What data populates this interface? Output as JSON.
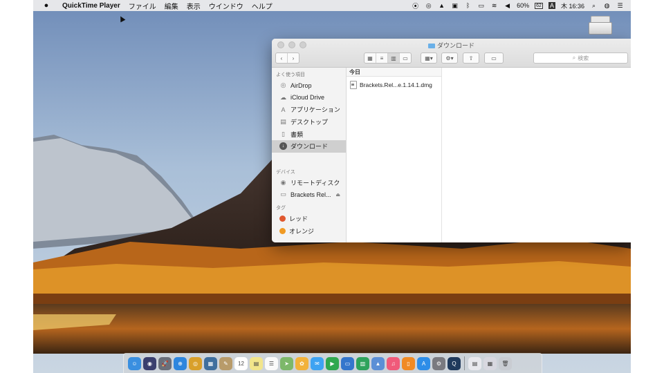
{
  "menubar": {
    "apple": "",
    "app_name": "QuickTime Player",
    "menus": [
      "ファイル",
      "編集",
      "表示",
      "ウインドウ",
      "ヘルプ"
    ],
    "battery_percent": "60%",
    "battery_badge": "62",
    "input_method": "A",
    "clock": "木 16:36",
    "status_icons": [
      "record-icon",
      "target-icon",
      "hat-icon",
      "clipboard-icon",
      "bluetooth-icon",
      "battery-icon",
      "wifi-icon",
      "volume-icon"
    ],
    "right_icons": [
      "search-icon",
      "user-icon",
      "list-icon"
    ]
  },
  "finder": {
    "title": "ダウンロード",
    "search_placeholder": "検索",
    "sidebar": {
      "favorites_header": "よく使う項目",
      "favorites": [
        {
          "label": "AirDrop",
          "icon": "airdrop-icon"
        },
        {
          "label": "iCloud Drive",
          "icon": "cloud-icon"
        },
        {
          "label": "アプリケーション",
          "icon": "applications-icon"
        },
        {
          "label": "デスクトップ",
          "icon": "desktop-icon"
        },
        {
          "label": "書類",
          "icon": "document-icon"
        },
        {
          "label": "ダウンロード",
          "icon": "download-icon"
        }
      ],
      "devices_header": "デバイス",
      "devices": [
        {
          "label": "リモートディスク",
          "icon": "disc-icon"
        },
        {
          "label": "Brackets Rel...",
          "icon": "drive-icon"
        }
      ],
      "tags_header": "タグ",
      "tags": [
        {
          "label": "レッド",
          "color": "#e0582f"
        },
        {
          "label": "オレンジ",
          "color": "#f09a23"
        }
      ]
    },
    "column": {
      "header": "今日",
      "files": [
        {
          "name": "Brackets.Rel...e.1.14.1.dmg",
          "icon": "dmg-file-icon"
        }
      ]
    }
  },
  "dock": {
    "icons": [
      {
        "name": "finder",
        "color": "#3a8fe0",
        "glyph": "☺"
      },
      {
        "name": "siri",
        "color": "#3b3f6e",
        "glyph": "◉"
      },
      {
        "name": "launchpad",
        "color": "#6a6f7a",
        "glyph": "🚀"
      },
      {
        "name": "safari",
        "color": "#2e86de",
        "glyph": "⊕"
      },
      {
        "name": "chrome",
        "color": "#d9a02b",
        "glyph": "◎"
      },
      {
        "name": "photos-edit",
        "color": "#3f6f9e",
        "glyph": "▦"
      },
      {
        "name": "notes-app",
        "color": "#b89b6a",
        "glyph": "✎"
      },
      {
        "name": "calendar",
        "color": "#ffffff",
        "glyph": "12"
      },
      {
        "name": "stickies",
        "color": "#f2e58b",
        "glyph": "▤"
      },
      {
        "name": "reminders",
        "color": "#fafafa",
        "glyph": "☰"
      },
      {
        "name": "maps",
        "color": "#7db86a",
        "glyph": "➤"
      },
      {
        "name": "photos",
        "color": "#f2b23a",
        "glyph": "✿"
      },
      {
        "name": "messages",
        "color": "#3ea3f2",
        "glyph": "✉"
      },
      {
        "name": "facetime",
        "color": "#2fa84f",
        "glyph": "▶"
      },
      {
        "name": "keynote",
        "color": "#3476cc",
        "glyph": "▭"
      },
      {
        "name": "numbers",
        "color": "#2ea35c",
        "glyph": "▥"
      },
      {
        "name": "keynote-podium",
        "color": "#5c8fd6",
        "glyph": "▲"
      },
      {
        "name": "music",
        "color": "#f05a7a",
        "glyph": "♫"
      },
      {
        "name": "books",
        "color": "#f08a24",
        "glyph": "▯"
      },
      {
        "name": "app-store",
        "color": "#2d8de8",
        "glyph": "A"
      },
      {
        "name": "system-preferences",
        "color": "#7a7a80",
        "glyph": "⚙"
      },
      {
        "name": "quicktime",
        "color": "#203a5c",
        "glyph": "Q"
      }
    ],
    "trailing": [
      {
        "name": "document",
        "color": "#e9e9ee",
        "glyph": "▤"
      },
      {
        "name": "preview-window",
        "color": "#d8d8e0",
        "glyph": "▦"
      },
      {
        "name": "trash",
        "color": "#c9ccd2",
        "glyph": "🗑"
      }
    ]
  }
}
